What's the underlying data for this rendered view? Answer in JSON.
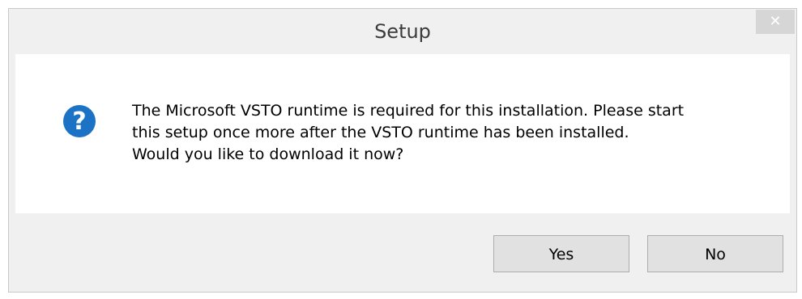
{
  "window": {
    "title": "Setup",
    "close_glyph": "✕"
  },
  "dialog": {
    "icon": "question-icon",
    "icon_glyph": "?",
    "icon_color": "#1c72c4",
    "message_lines": [
      "The Microsoft VSTO runtime is required for this installation. Please start",
      "this setup once more after the VSTO runtime has been installed.",
      "Would you like to download it now?"
    ]
  },
  "buttons": {
    "yes_label": "Yes",
    "no_label": "No"
  }
}
